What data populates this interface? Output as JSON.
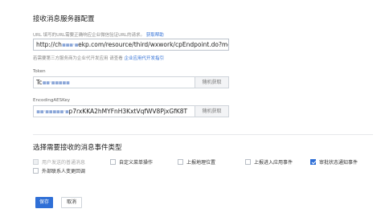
{
  "server_config": {
    "title": "接收消息服务器配置",
    "url_hint": {
      "prefix": "URL",
      "text": "填写的URL需要正确响应企业微信验证URL的请求。",
      "help_link": "获取帮助"
    },
    "url_value": "http://ch",
    "url_value_suffix": "ekp.com/resource/third/wxwork/cpEndpoint.do?met",
    "third_party_hint": {
      "text": "若需要第三方服务商为企业代开发应用 请查看",
      "link": "企业应用代开发指引"
    },
    "token_label": "Token",
    "token_value_prefix": "Tc",
    "token_button": "随机获取",
    "aeskey_label": "EncodingAESKey",
    "aeskey_value_suffix": "p7rxKKA2hMYFnH3KxtVqfWV8PjxGfK8T",
    "aeskey_button": "随机获取"
  },
  "events": {
    "title": "选择需要接收的消息事件类型",
    "options": [
      {
        "label": "用户发送的普通消息",
        "checked": false,
        "disabled": true
      },
      {
        "label": "自定义菜单操作",
        "checked": false,
        "disabled": false
      },
      {
        "label": "上报地理位置",
        "checked": false,
        "disabled": false
      },
      {
        "label": "上报进入应用事件",
        "checked": false,
        "disabled": false
      },
      {
        "label": "审批状态通知事件",
        "checked": true,
        "disabled": false
      },
      {
        "label": "外部联系人变更回调",
        "checked": false,
        "disabled": false
      }
    ]
  },
  "actions": {
    "save": "保存",
    "cancel": "取消"
  },
  "colors": {
    "primary": "#2f6fd6",
    "link": "#2f6fd6"
  }
}
